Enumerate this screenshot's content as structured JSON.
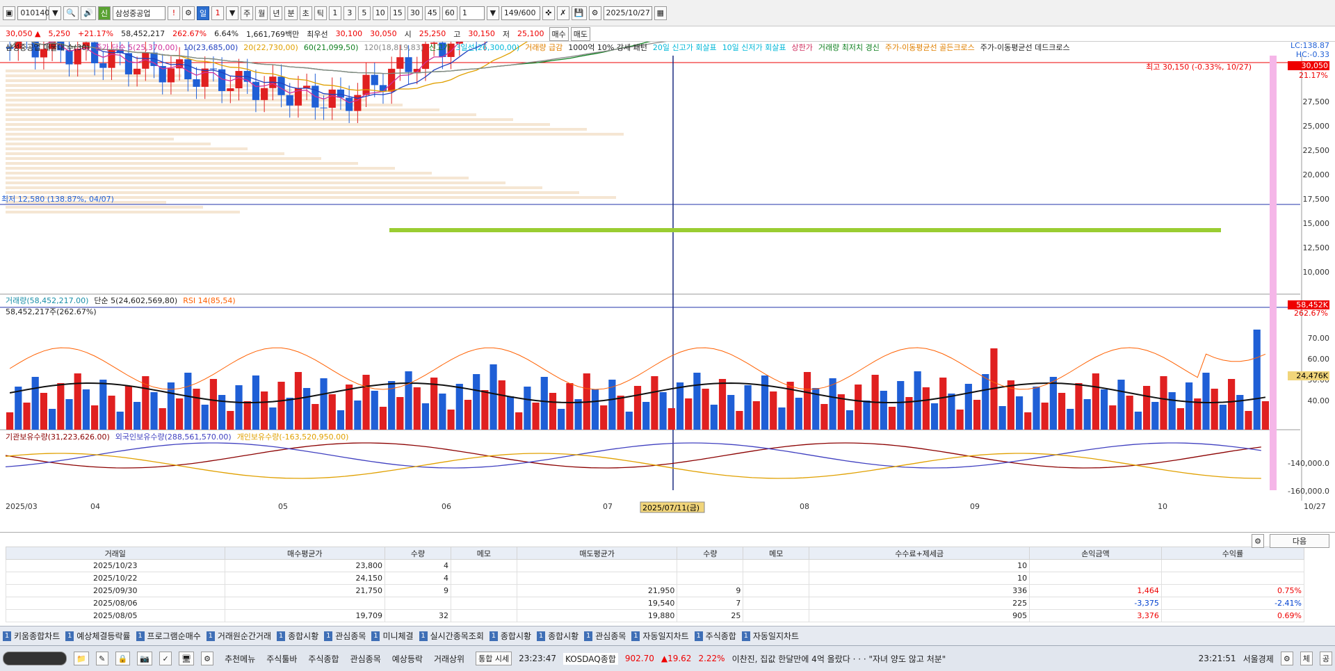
{
  "toolbar": {
    "code": "010140",
    "chin": "신",
    "name": "삼성중공업",
    "bang": "!",
    "period_il": "일",
    "num1": "1",
    "periods": [
      "주",
      "월",
      "년",
      "분",
      "초",
      "틱"
    ],
    "minutes": [
      "1",
      "3",
      "5",
      "10",
      "15",
      "30",
      "45",
      "60"
    ],
    "count_value": "1",
    "count_display": "149/600",
    "date": "2025/10/27"
  },
  "price": {
    "current": "30,050",
    "change": "5,250",
    "pct": "+21.17%",
    "volume": "58,452,217",
    "vol_ratio": "262.67%",
    "turnover": "6.64%",
    "amount": "1,661,769백만",
    "ref_label": "최우선",
    "ask": "30,100",
    "bid": "30,050",
    "open_label": "시",
    "open": "25,250",
    "high_label": "고",
    "high": "30,150",
    "low_label": "저",
    "low": "25,100",
    "buy": "매수",
    "sell": "매도"
  },
  "legend_top": [
    {
      "text": "삼성중공업 매물대 수(30)",
      "color": "#222"
    },
    {
      "text": "종가 단순 5(25,370,00)",
      "color": "#d0309a"
    },
    {
      "text": "10(23,685,00)",
      "color": "#2040c0"
    },
    {
      "text": "20(22,730,00)",
      "color": "#e0a000"
    },
    {
      "text": "60(21,099,50)",
      "color": "#108020"
    },
    {
      "text": "120(18,819,83)",
      "color": "#888"
    },
    {
      "text": "신고가",
      "color": "#108020"
    },
    {
      "text": "3일선(26,300,00)",
      "color": "#00b8d8"
    },
    {
      "text": "거래량 급감",
      "color": "#e08000"
    },
    {
      "text": "1000억 10% 강세 패턴",
      "color": "#222"
    },
    {
      "text": "20일 신고가 회살표",
      "color": "#00b8d8"
    },
    {
      "text": "10일 신저가 회살표",
      "color": "#00b8d8"
    },
    {
      "text": "상한가",
      "color": "#d03060"
    },
    {
      "text": "거래량 최저치 경신",
      "color": "#108020"
    },
    {
      "text": "주가-이동평균선 골든크로스",
      "color": "#e08000"
    },
    {
      "text": "주가-이동평균선 데드크로스",
      "color": "#222"
    }
  ],
  "right_info": {
    "lc": "LC:138.87",
    "hc": "HC:-0.33",
    "last_price": "30,050",
    "last_pct": "21.17%",
    "last_vol": "58,452K",
    "last_vol_pct": "262.67%",
    "avg_line": "24,476K",
    "high_note": "최고 30,150 (-0.33%, 10/27)",
    "low_note": "최저 12,580 (138.87%, 04/07)"
  },
  "price_axis": [
    "27,500",
    "25,000",
    "22,500",
    "20,000",
    "17,500",
    "15,000",
    "12,500",
    "10,000"
  ],
  "vol_axis": [
    "70.00",
    "60.00",
    "50.00",
    "40.00"
  ],
  "inv_axis": [
    "-140,000.0",
    "-160,000.0"
  ],
  "legend_vol": [
    {
      "text": "거래량(58,452,217.00)",
      "color": "#1a8fa8"
    },
    {
      "text": "단순 5(24,602,569,80)",
      "color": "#222"
    },
    {
      "text": "RSI 14(85,54)",
      "color": "#ff6000"
    }
  ],
  "vol_sub": "58,452,217주(262.67%)",
  "legend_inv": [
    {
      "text": "기관보유수량(31,223,626.00)",
      "color": "#8b0000"
    },
    {
      "text": "외국인보유수량(288,561,570.00)",
      "color": "#4040c0"
    },
    {
      "text": "개인보유수량(-163,520,950.00)",
      "color": "#e0a000"
    }
  ],
  "months": [
    "2025/03",
    "04",
    "05",
    "06",
    "07",
    "08",
    "09",
    "10",
    "10/27"
  ],
  "crosshair_date": "2025/07/11(금)",
  "footer": {
    "next": "다음"
  },
  "grid": {
    "headers": [
      "거래일",
      "매수평균가",
      "수량",
      "메모",
      "매도평균가",
      "수량",
      "메모",
      "수수료+제세금",
      "손익금액",
      "수익률"
    ],
    "rows": [
      [
        "2025/10/23",
        "23,800",
        "4",
        "",
        "",
        "",
        "",
        "10",
        "",
        ""
      ],
      [
        "2025/10/22",
        "24,150",
        "4",
        "",
        "",
        "",
        "",
        "10",
        "",
        ""
      ],
      [
        "2025/09/30",
        "21,750",
        "9",
        "",
        "21,950",
        "9",
        "",
        "336",
        "1,464",
        "0.75%"
      ],
      [
        "2025/08/06",
        "",
        "",
        "",
        "19,540",
        "7",
        "",
        "225",
        "-3,375",
        "-2.41%"
      ],
      [
        "2025/08/05",
        "19,709",
        "32",
        "",
        "19,880",
        "25",
        "",
        "905",
        "3,376",
        "0.69%"
      ]
    ]
  },
  "tasks": [
    "키움종합차트",
    "예상체결등락률",
    "프로그램순매수",
    "거래원순간거래",
    "종합시황",
    "관심종목",
    "미니체결",
    "실시간종목조회",
    "종합시황",
    "종합시황",
    "관심종목",
    "자동일지차트",
    "주식종합",
    "자동일지차트"
  ],
  "status": {
    "menus": [
      "추천메뉴",
      "주식툴바",
      "주식종합",
      "관심종목",
      "예상등락",
      "거래상위"
    ],
    "integrated": "통합 시세",
    "clock": "23:23:47",
    "index_name": "KOSDAQ종합",
    "index_val": "902.70",
    "index_chg": "▲19.62",
    "index_pct": "2.22%",
    "news": "이찬진, 집값 한달만에 4억 올랐다 · · · \"자녀 양도 않고 처분\"",
    "news_time": "23:21:51",
    "news_src": "서울경제",
    "sep": "체",
    "sep2": "공"
  }
}
